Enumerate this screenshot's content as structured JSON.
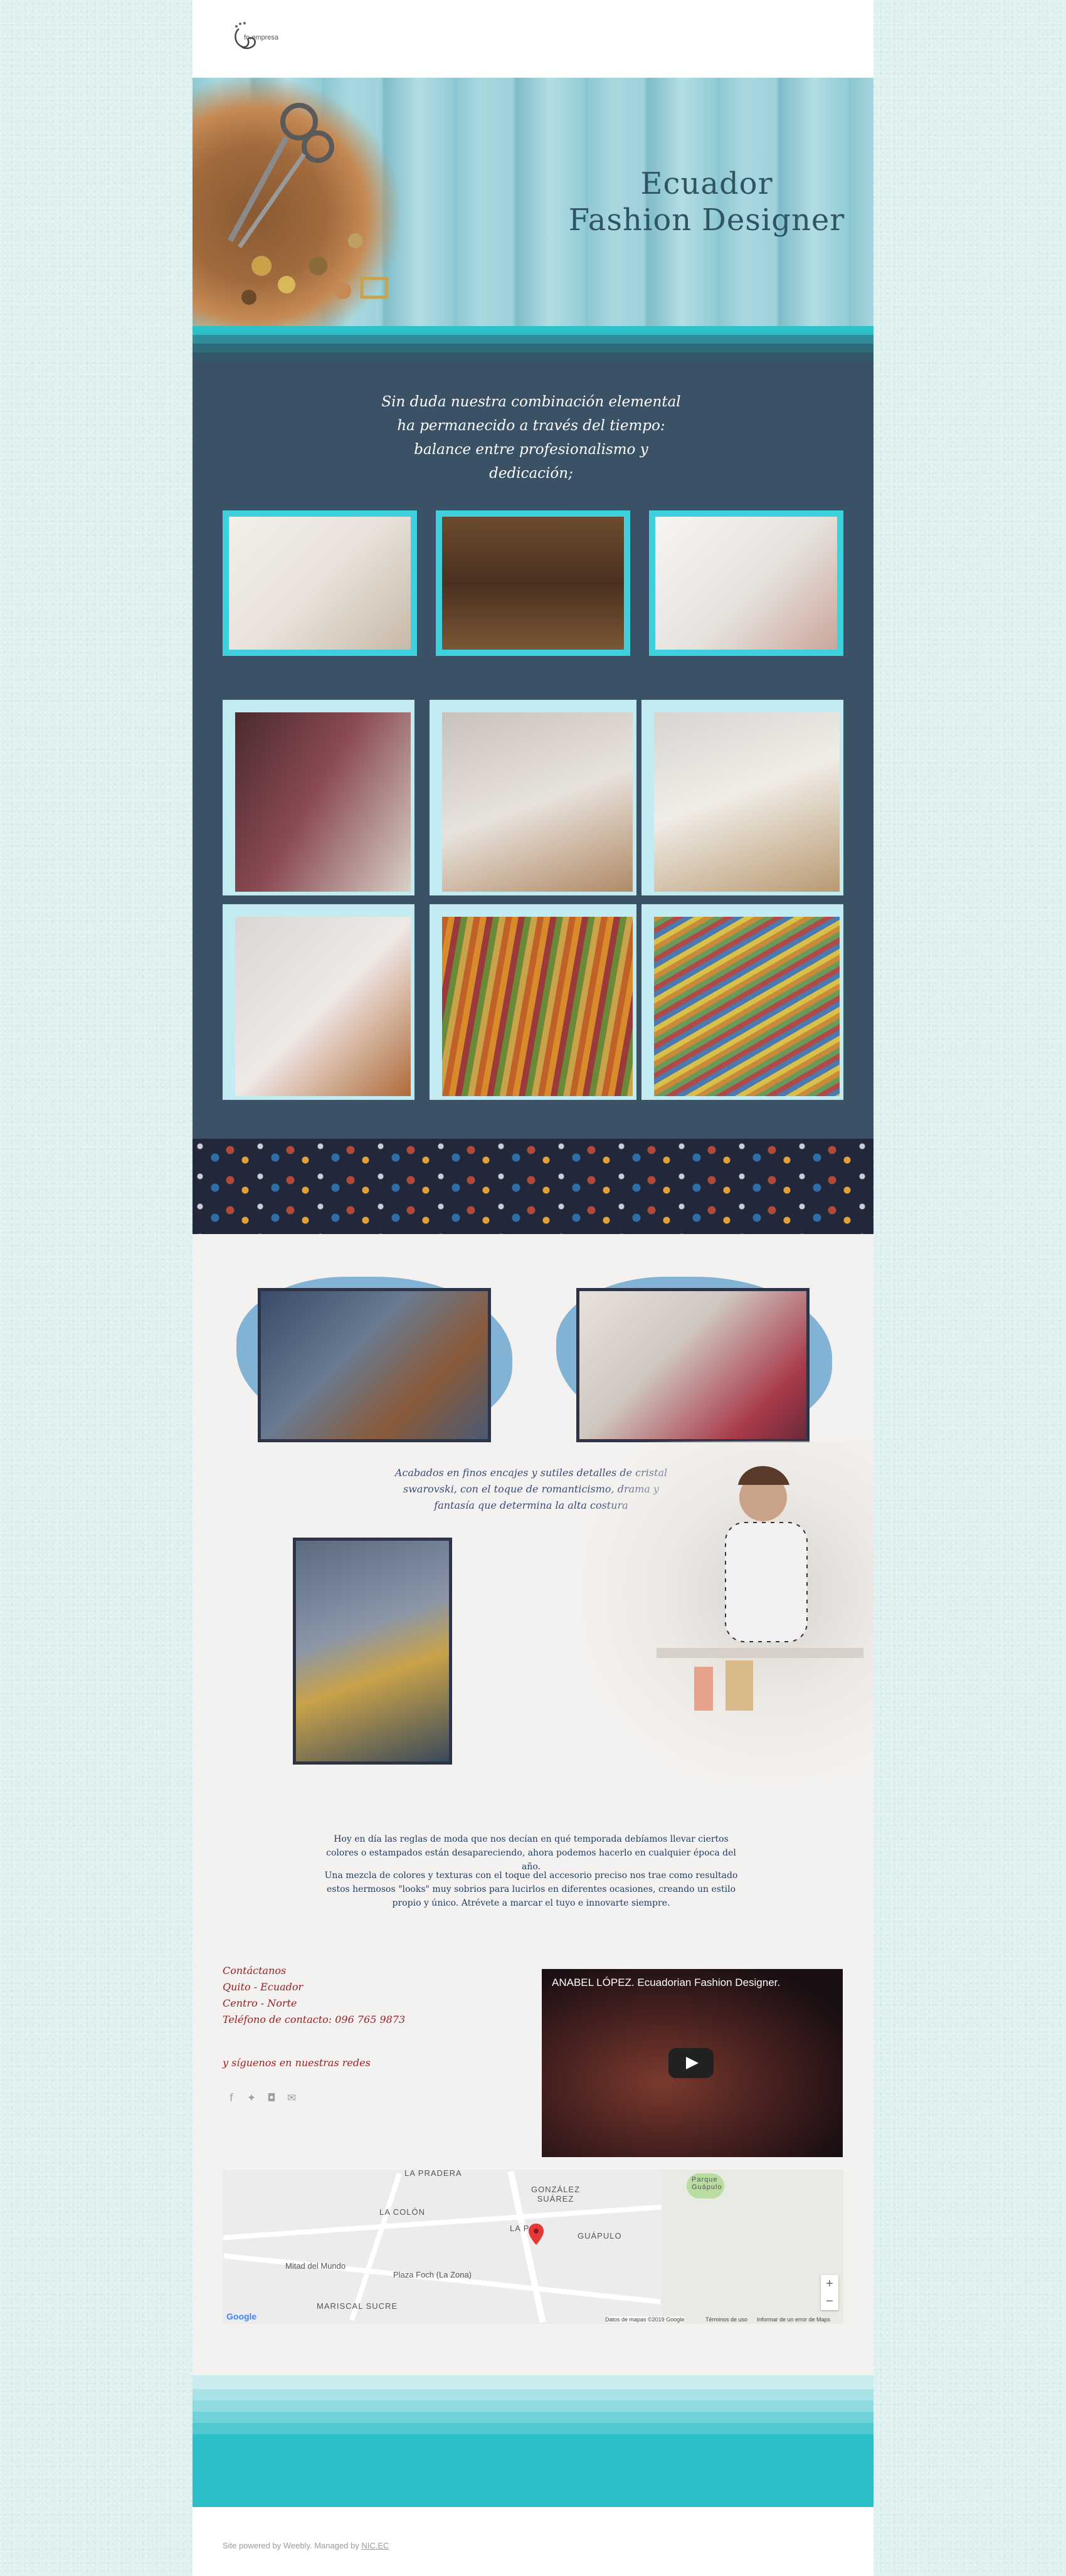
{
  "brand": {
    "logo_text": "fo.empresa"
  },
  "hero": {
    "title_line1": "Ecuador",
    "title_line2": "Fashion Designer"
  },
  "intro": {
    "quote": "Sin duda nuestra combinación elemental ha permanecido a través del tiempo: balance entre profesionalismo y dedicación;"
  },
  "gallery": {
    "tiles": [
      "fashion-sketches",
      "button-box",
      "sewing-machine"
    ],
    "frames": [
      "drawing-hand",
      "color-wheel-easel",
      "desk-plant",
      "paper-cutout",
      "colored-pencils",
      "pencils-spread"
    ]
  },
  "showcase": {
    "caption": "Acabados en finos encajes y sutiles detalles de cristal swarovski, con el toque de romanticismo, drama y fantasía que determina la alta costura",
    "paragraph1": "Hoy en día las reglas de moda que nos decían en qué temporada debíamos llevar ciertos colores o estampados están desapareciendo, ahora podemos hacerlo en cualquier época del año.",
    "paragraph2": "Una mezcla de colores y texturas con el toque del accesorio preciso nos trae como resultado estos hermosos \"looks\" muy sobrios para lucirlos en diferentes ocasiones, creando un estilo propio y único. Atrévete a marcar el tuyo e innovarte siempre."
  },
  "contact": {
    "line1": "Contáctanos",
    "line2": "Quito - Ecuador",
    "line3": "Centro - Norte",
    "line4": "Teléfono de contacto: 096 765 9873",
    "follow": "y síguenos en nuestras redes"
  },
  "social_icons": [
    "facebook-icon",
    "twitter-icon",
    "instagram-icon",
    "mail-icon"
  ],
  "video": {
    "title": "ANABEL LÓPEZ. Ecuadorian Fashion Designer."
  },
  "map": {
    "labels": [
      "LA PRADERA",
      "GONZÁLEZ SUÁREZ",
      "LA COLÓN",
      "LA PAZ",
      "GUÁPULO",
      "Mitad del Mundo",
      "Plaza Foch (La Zona)",
      "MARISCAL SUCRE",
      "Parque Guápulo"
    ],
    "attribution": "Datos de mapas ©2019 Google",
    "terms": "Términos de uso",
    "report": "Informar de un error de Maps",
    "google": "Google",
    "zoom_in": "+",
    "zoom_out": "−"
  },
  "footer": {
    "text": "Site powered by Weebly. Managed by",
    "link": "NIC.EC"
  },
  "colors": {
    "accent": "#2cc0c9",
    "dark": "#3a5166",
    "contact": "#9b2020"
  }
}
